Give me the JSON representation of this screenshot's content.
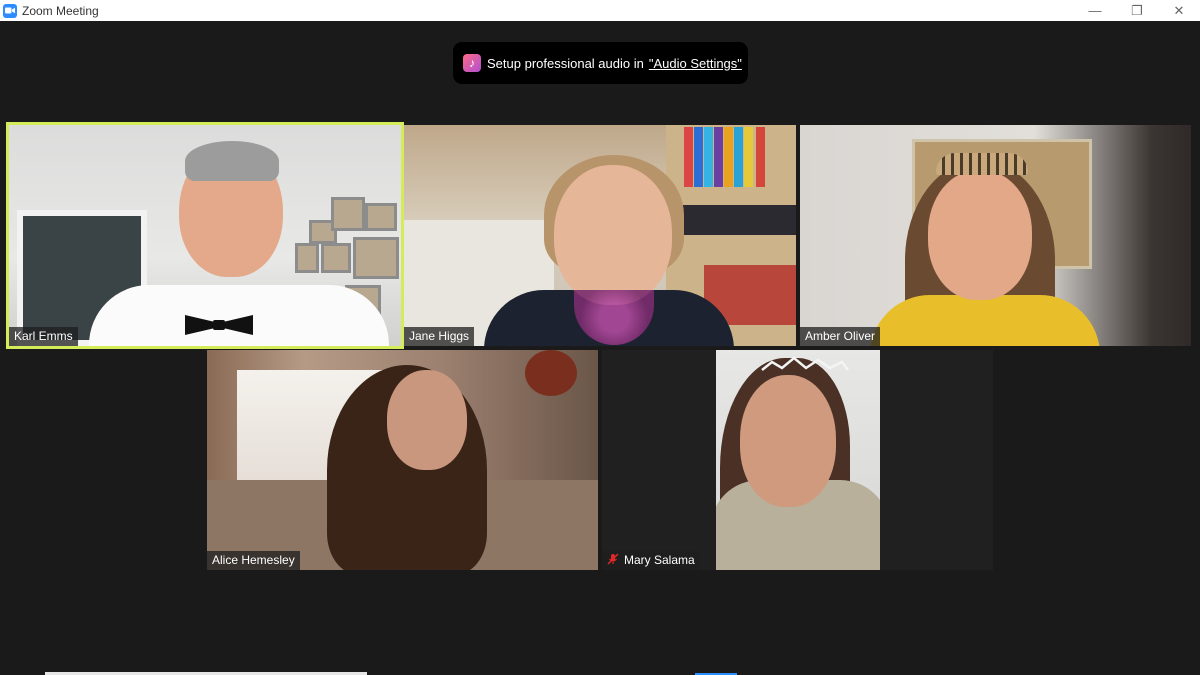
{
  "window": {
    "title": "Zoom Meeting",
    "minimize_label": "—",
    "restore_label": "❐",
    "close_label": "✕"
  },
  "banner": {
    "text": "Setup professional audio in",
    "link": "\"Audio Settings\""
  },
  "participants": [
    {
      "name": "Karl Emms",
      "active_speaker": true,
      "muted": false
    },
    {
      "name": "Jane Higgs",
      "active_speaker": false,
      "muted": false
    },
    {
      "name": "Amber Oliver",
      "active_speaker": false,
      "muted": false
    },
    {
      "name": "Alice Hemesley",
      "active_speaker": false,
      "muted": false
    },
    {
      "name": "Mary Salama",
      "active_speaker": false,
      "muted": true
    }
  ],
  "colors": {
    "active_speaker_border": "#d4ec5a",
    "zoom_blue": "#2d8cff",
    "muted_red": "#e02828"
  }
}
